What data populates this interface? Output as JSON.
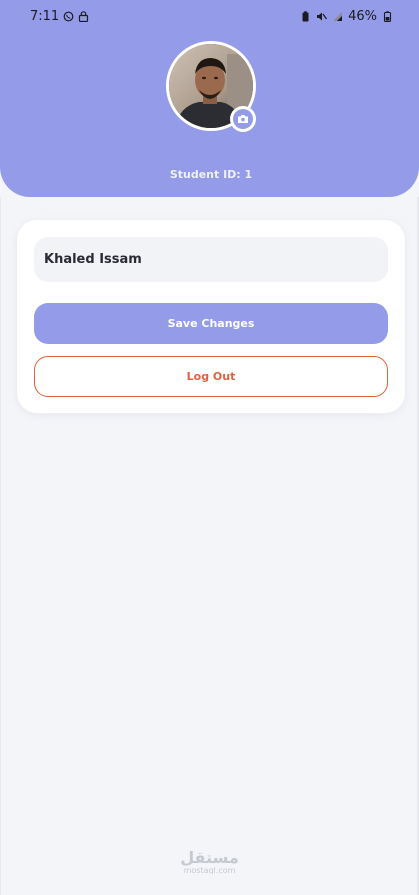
{
  "status_bar": {
    "time": "7:11",
    "battery": "46%",
    "icons_left": [
      "whatsapp-icon",
      "lock-icon"
    ],
    "icons_right": [
      "battery-saver-icon",
      "mute-icon",
      "signal-icon",
      "battery-icon"
    ]
  },
  "profile": {
    "student_id": "Student ID: 1",
    "name": "Khaled Issam"
  },
  "actions": {
    "save_label": "Save Changes",
    "logout_label": "Log Out"
  },
  "watermark": {
    "main": "مستقل",
    "sub": "mostaql.com"
  },
  "colors": {
    "accent": "#949be8",
    "danger": "#e0613d",
    "background": "#f3f5f9"
  }
}
